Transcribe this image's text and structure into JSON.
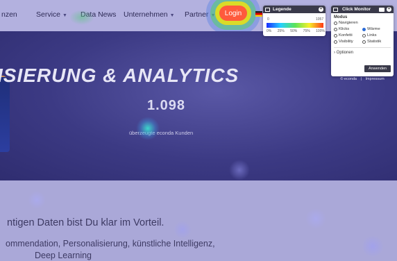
{
  "nav": {
    "items": [
      {
        "label": "nzen",
        "chevron": false
      },
      {
        "label": "Service",
        "chevron": true
      },
      {
        "label": "Data News",
        "chevron": false
      },
      {
        "label": "Unternehmen",
        "chevron": true
      },
      {
        "label": "Partner",
        "chevron": true
      }
    ],
    "login_label": "Login"
  },
  "hero": {
    "title": "ISIERUNG & ANALYTICS",
    "count": "1.098",
    "subtitle": "überzeugte econda Kunden"
  },
  "content": {
    "line1": "ntigen Daten bist Du klar im Vorteil.",
    "line2": "ommendation, Personalisierung, künstliche Intelligenz,",
    "line3": "Deep Learning"
  },
  "legend": {
    "title": "Legende",
    "min": "0",
    "max": "1057",
    "ticks": [
      "0%",
      "25%",
      "50%",
      "75%",
      "100%"
    ]
  },
  "monitor": {
    "title": "Click Monitor",
    "mode_label": "Modus",
    "modes": [
      {
        "label": "Navigieren",
        "selected": false
      },
      {
        "label": "Klicks",
        "selected": false
      },
      {
        "label": "Wärme",
        "selected": true
      },
      {
        "label": "Konfetti",
        "selected": false
      },
      {
        "label": "Links",
        "selected": false
      },
      {
        "label": "Visibility",
        "selected": false
      },
      {
        "label": "Statistik",
        "selected": false
      }
    ],
    "options_label": "Optionen",
    "apply_label": "Anwenden",
    "footer_brand": "© econda",
    "footer_separator": "|",
    "footer_link": "Impressum"
  },
  "colors": {
    "login": "#ff5a3c",
    "hero_bg": "#3c3a84",
    "selected_radio": "#2b6bd6"
  }
}
